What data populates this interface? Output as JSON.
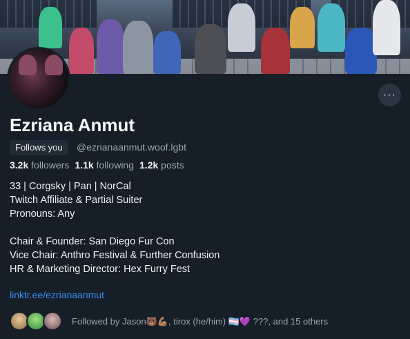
{
  "profile": {
    "display_name": "Ezriana Anmut",
    "follows_you_badge": "Follows you",
    "handle": "@ezrianaanmut.woof.lgbt",
    "more_button_icon": "more-horizontal-icon",
    "more_button_glyph": "···"
  },
  "stats": {
    "followers_count": "3.2k",
    "followers_label": "followers",
    "following_count": "1.1k",
    "following_label": "following",
    "posts_count": "1.2k",
    "posts_label": "posts"
  },
  "bio": {
    "lines": [
      "33 | Corgsky | Pan | NorCal",
      "Twitch Affiliate & Partial Suiter",
      "Pronouns: Any",
      "",
      "Chair & Founder: San Diego Fur Con",
      "Vice Chair: Anthro Festival & Further Confusion",
      "HR & Marketing Director: Hex Furry Fest"
    ],
    "link": "linktr.ee/ezrianaanmut"
  },
  "known_followers": {
    "text": "Followed by Jason🐻💪🏽, tirox (he/him) 🏳️‍⚧️💜 ???, and 15 others"
  },
  "colors": {
    "background": "#161e27",
    "link": "#3d8ef5",
    "muted_text": "#9aa6b3",
    "badge_bg": "#222c38"
  }
}
